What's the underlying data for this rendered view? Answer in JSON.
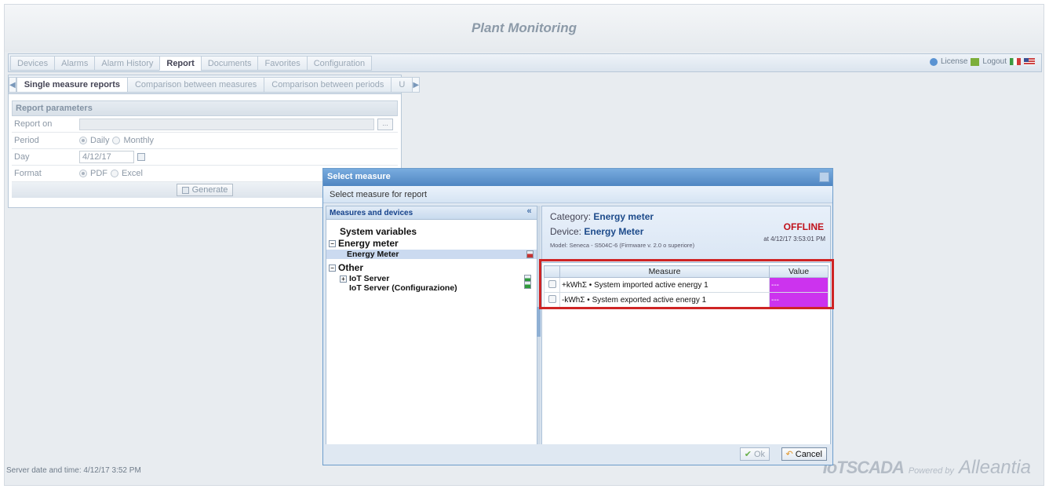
{
  "app": {
    "title": "Plant Monitoring"
  },
  "main_tabs": [
    {
      "label": "Devices"
    },
    {
      "label": "Alarms"
    },
    {
      "label": "Alarm History"
    },
    {
      "label": "Report"
    },
    {
      "label": "Documents"
    },
    {
      "label": "Favorites"
    },
    {
      "label": "Configuration"
    }
  ],
  "topright": {
    "license": "License",
    "logout": "Logout"
  },
  "sub_tabs": [
    {
      "label": "Single measure reports"
    },
    {
      "label": "Comparison between measures"
    },
    {
      "label": "Comparison between periods"
    },
    {
      "label": "U"
    }
  ],
  "report_params": {
    "title": "Report parameters",
    "report_on_label": "Report on",
    "period_label": "Period",
    "period_daily": "Daily",
    "period_monthly": "Monthly",
    "day_label": "Day",
    "day_value": "4/12/17",
    "format_label": "Format",
    "format_pdf": "PDF",
    "format_excel": "Excel",
    "generate": "Generate",
    "ellipsis": "..."
  },
  "dialog": {
    "title": "Select measure",
    "subtitle": "Select measure for report",
    "left_header": "Measures and devices",
    "tree": {
      "system_variables": "System variables",
      "energy_meter_group": "Energy meter",
      "energy_meter_device": "Energy Meter",
      "other_group": "Other",
      "iot_server": "IoT Server",
      "iot_server_config": "IoT Server (Configurazione)"
    },
    "info": {
      "category_label": "Category:",
      "category_value": "Energy meter",
      "device_label": "Device:",
      "device_value": "Energy Meter",
      "model": "Model: Seneca - S504C-6 (Firmware v. 2.0 o superiore)",
      "status": "OFFLINE",
      "status_time": "at 4/12/17 3:53:01 PM"
    },
    "table": {
      "headers": {
        "measure": "Measure",
        "value": "Value"
      },
      "rows": [
        {
          "measure": "+kWhΣ • System imported active energy 1",
          "value": "---"
        },
        {
          "measure": "-kWhΣ • System exported active energy 1",
          "value": "---"
        }
      ]
    },
    "ok": "Ok",
    "cancel": "Cancel"
  },
  "footer": {
    "server_time": "Server date and time: 4/12/17 3:52 PM",
    "logo_iot": "IoTSCADA",
    "logo_powered": "Powered by",
    "logo_alleantia": "Alleantia"
  },
  "colors": {
    "accent": "#4f86c2",
    "offline": "#c0111b",
    "value_cell": "#cc33ee",
    "highlight": "#cf2424"
  }
}
